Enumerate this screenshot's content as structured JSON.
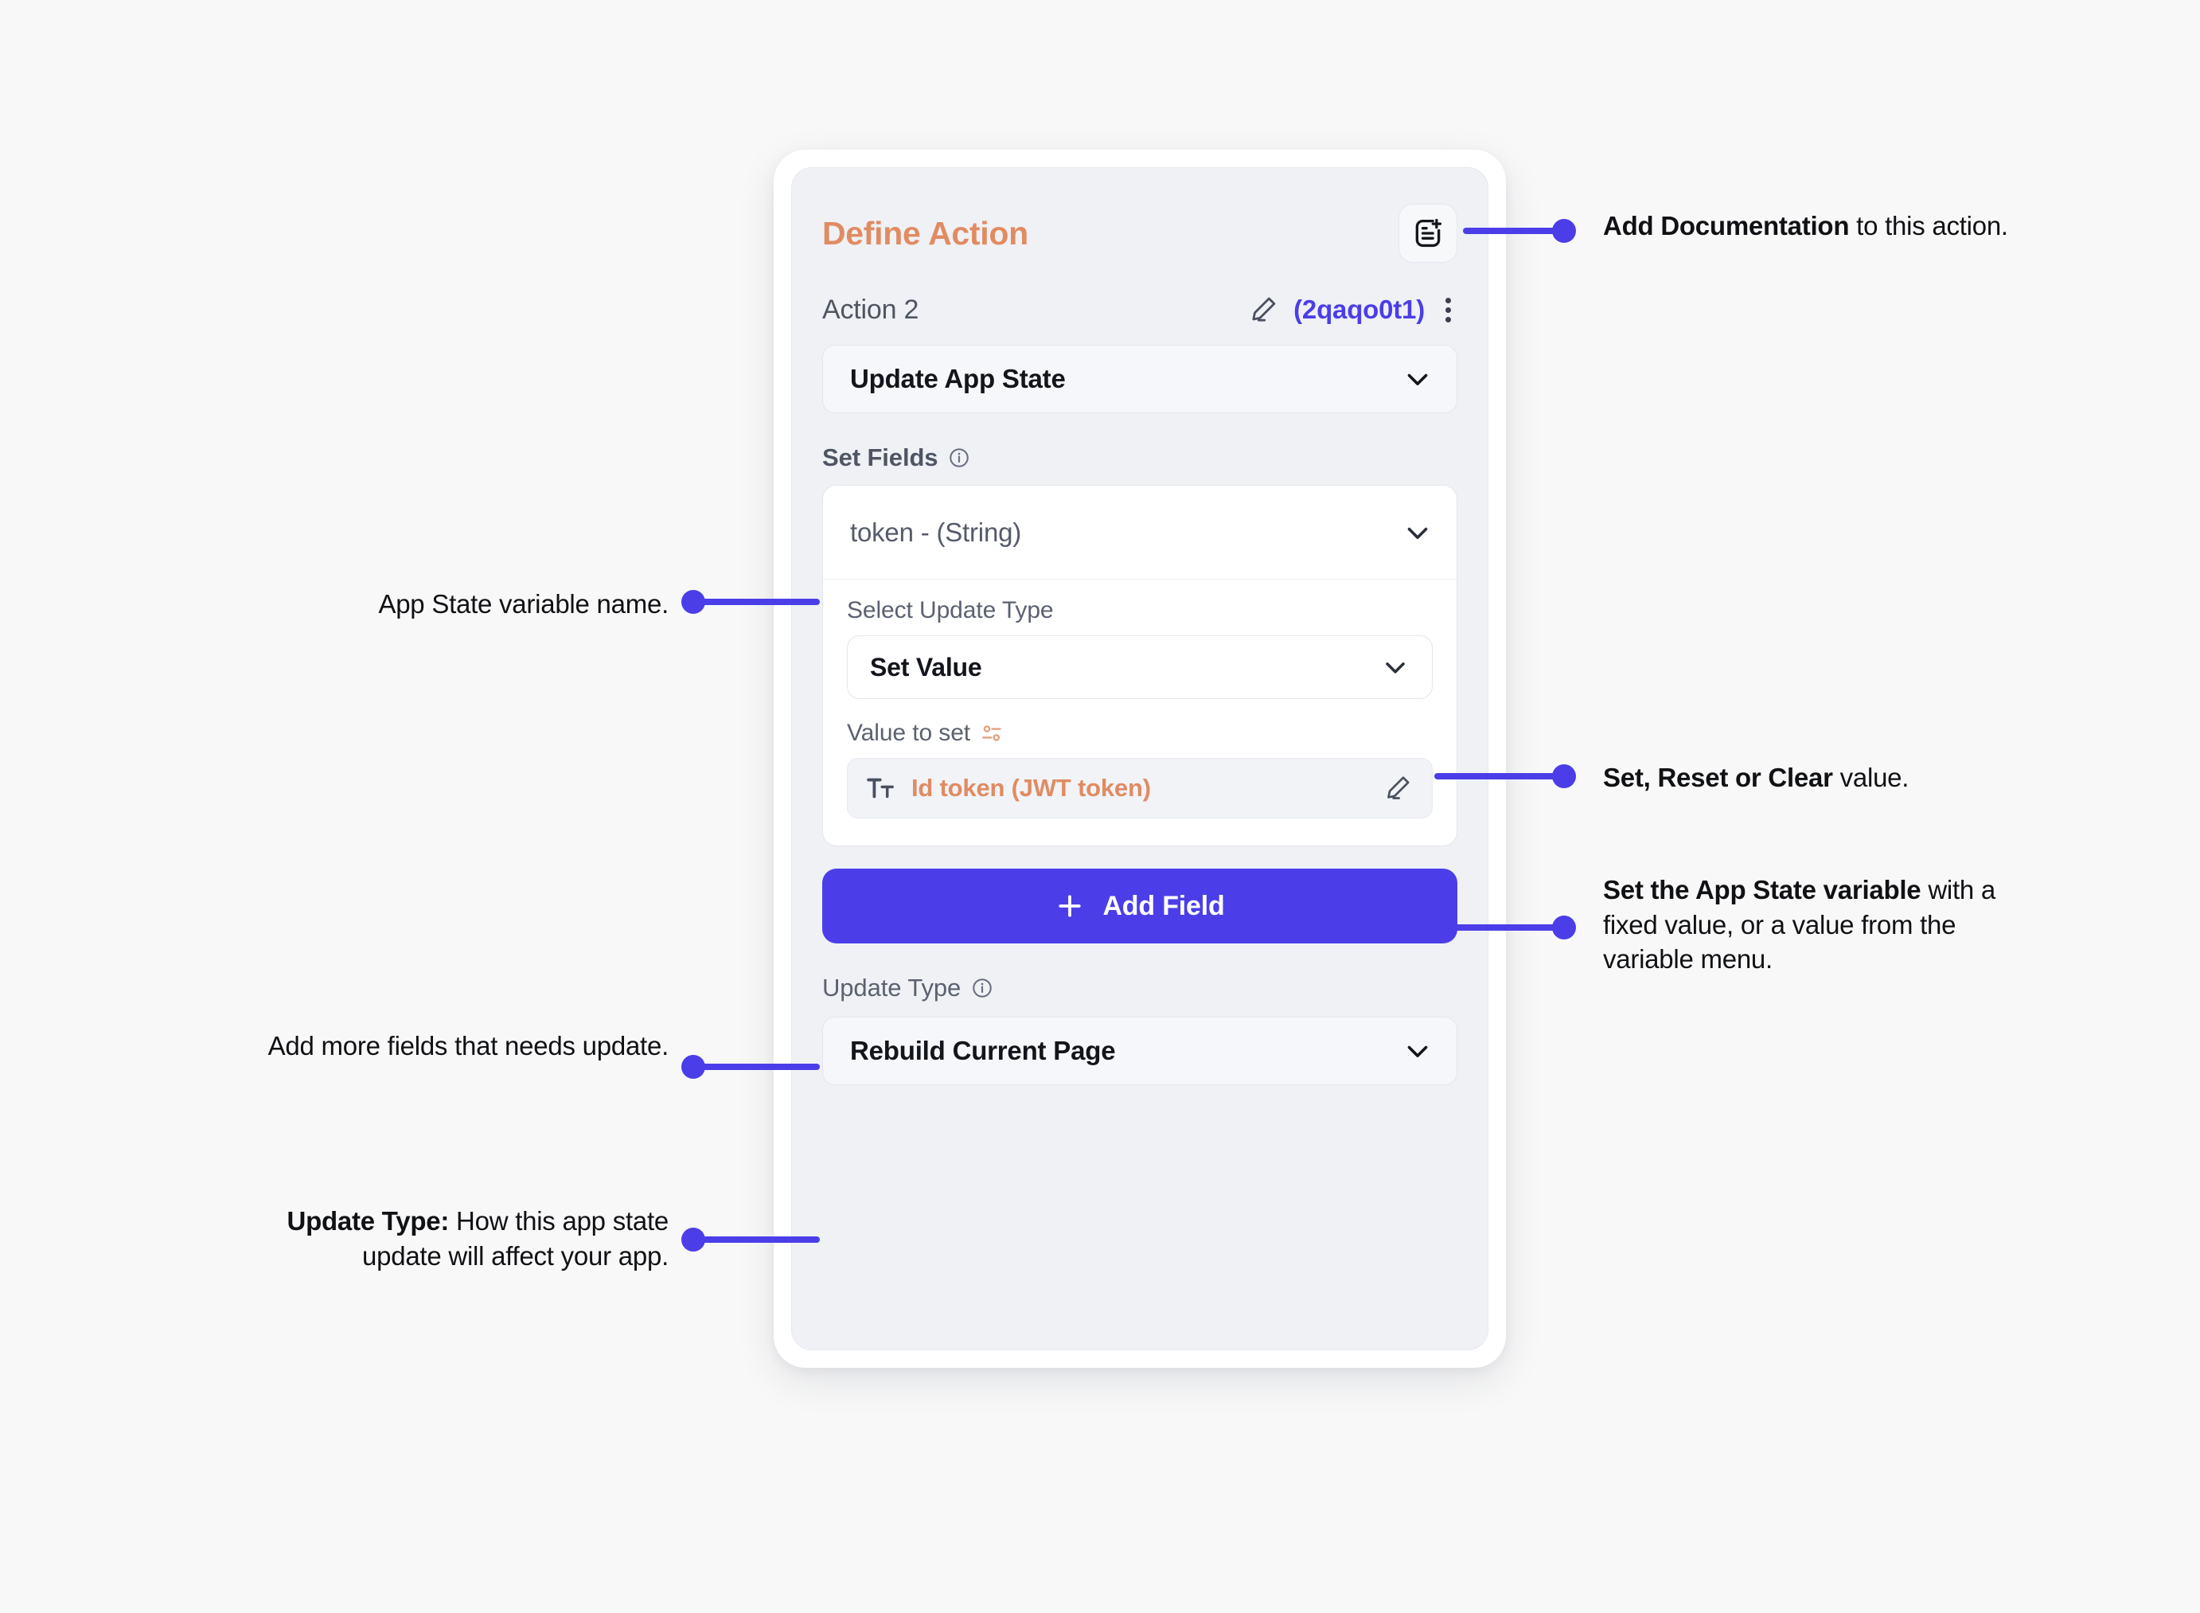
{
  "theme": {
    "background": "#f8f8f8",
    "accent_purple": "#4b3ee8",
    "accent_orange": "#e08b62",
    "card_bg": "#eff1f5",
    "frame_bg": "#ffffff"
  },
  "panel": {
    "title": "Define Action",
    "doc_button_icon": "document-add-icon",
    "action": {
      "label": "Action 2",
      "edit_icon": "pencil-icon",
      "id": "(2qaqo0t1)",
      "more_icon": "kebab-menu-icon"
    },
    "action_type_select": {
      "value": "Update App State",
      "chevron": "chevron-down-icon"
    },
    "set_fields": {
      "label": "Set Fields",
      "info_icon": "info-icon",
      "field": {
        "variable": "token - (String)",
        "variable_chevron": "chevron-down-icon",
        "update_type_label": "Select Update Type",
        "update_type_value": "Set Value",
        "update_type_chevron": "chevron-down-icon",
        "value_to_set_label": "Value to set",
        "value_to_set_icon": "sliders-icon",
        "value_type_icon": "text-format-icon",
        "value_text": "Id token (JWT token)",
        "value_edit_icon": "pencil-icon"
      }
    },
    "add_field_button": {
      "label": "Add Field",
      "icon": "plus-icon"
    },
    "update_type": {
      "label": "Update Type",
      "info_icon": "info-icon",
      "value": "Rebuild Current Page",
      "chevron": "chevron-down-icon"
    }
  },
  "annotations": {
    "add_documentation": {
      "bold": "Add Documentation",
      "rest": " to this action."
    },
    "app_state_variable_name": {
      "text": "App State variable name."
    },
    "set_reset_clear": {
      "bold": "Set, Reset or Clear",
      "rest": " value."
    },
    "set_app_state_variable": {
      "bold": "Set the App State variable",
      "rest": " with a fixed value, or a value from the variable menu."
    },
    "add_more_fields": {
      "text": "Add more fields that needs update."
    },
    "update_type_note": {
      "bold": "Update Type:",
      "rest": " How this app state update will affect your app."
    }
  }
}
